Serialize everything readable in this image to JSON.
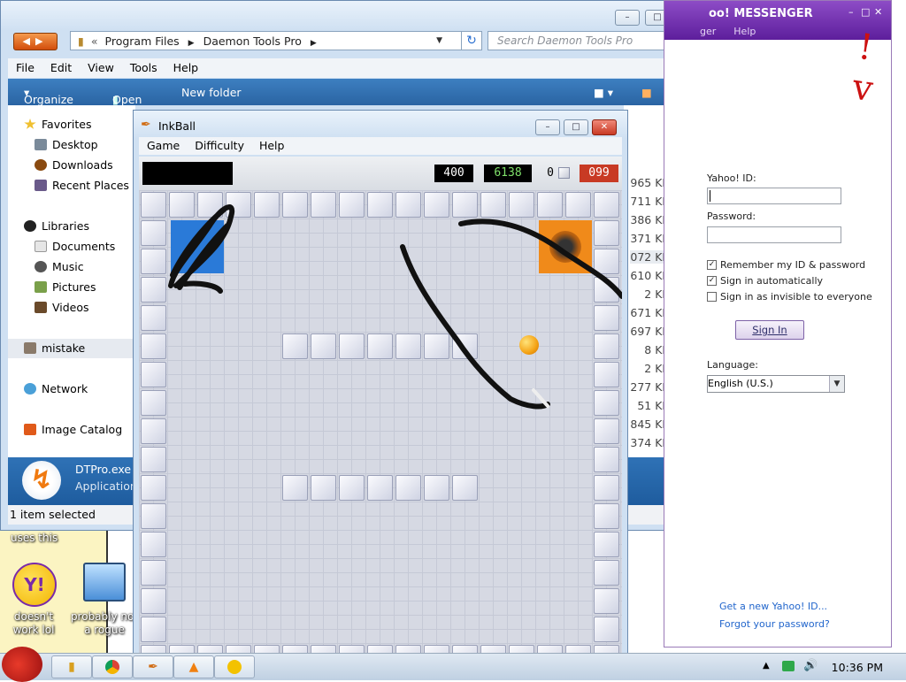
{
  "desktop": {
    "icon_labels": [
      "doesn't work lol",
      "probably not a rogue"
    ],
    "overlay_text": "uses this"
  },
  "explorer": {
    "breadcrumb": [
      "Program Files",
      "Daemon Tools Pro"
    ],
    "search_placeholder": "Search Daemon Tools Pro",
    "menu": [
      "File",
      "Edit",
      "View",
      "Tools",
      "Help"
    ],
    "commands": {
      "organize": "Organize",
      "open": "Open",
      "new_folder": "New folder"
    },
    "nav": {
      "favorites": "Favorites",
      "desktop": "Desktop",
      "downloads": "Downloads",
      "recent": "Recent Places",
      "libraries": "Libraries",
      "documents": "Documents",
      "music": "Music",
      "pictures": "Pictures",
      "videos": "Videos",
      "mistake": "mistake",
      "network": "Network",
      "image_catalog": "Image Catalog"
    },
    "sizes": [
      "965 KB",
      "711 KB",
      "386 KB",
      "371 KB",
      "072 KB",
      "610 KB",
      "2 KB",
      "671 KB",
      "697 KB",
      "8 KB",
      "2 KB",
      "277 KB",
      "51 KB",
      "845 KB",
      "374 KB"
    ],
    "details": {
      "name": "DTPro.exe",
      "type": "Application"
    },
    "status": "1 item selected"
  },
  "yahoo": {
    "title": "oo! MESSENGER",
    "menu": [
      "ger",
      "Help"
    ],
    "id_label": "Yahoo! ID:",
    "password_label": "Password:",
    "remember": "Remember my ID & password",
    "auto_signin": "Sign in automatically",
    "invisible": "Sign in as invisible to everyone",
    "signin_button": "Sign In",
    "language_label": "Language:",
    "language_value": "English (U.S.)",
    "get_id": "Get a new Yahoo! ID...",
    "forgot": "Forgot your password?"
  },
  "inkball": {
    "title": "InkBall",
    "menu": [
      "Game",
      "Difficulty",
      "Help"
    ],
    "scores": {
      "level": "400",
      "total": "6138",
      "balls": "0",
      "timer": "099"
    }
  },
  "taskbar": {
    "clock": "10:36 PM"
  }
}
